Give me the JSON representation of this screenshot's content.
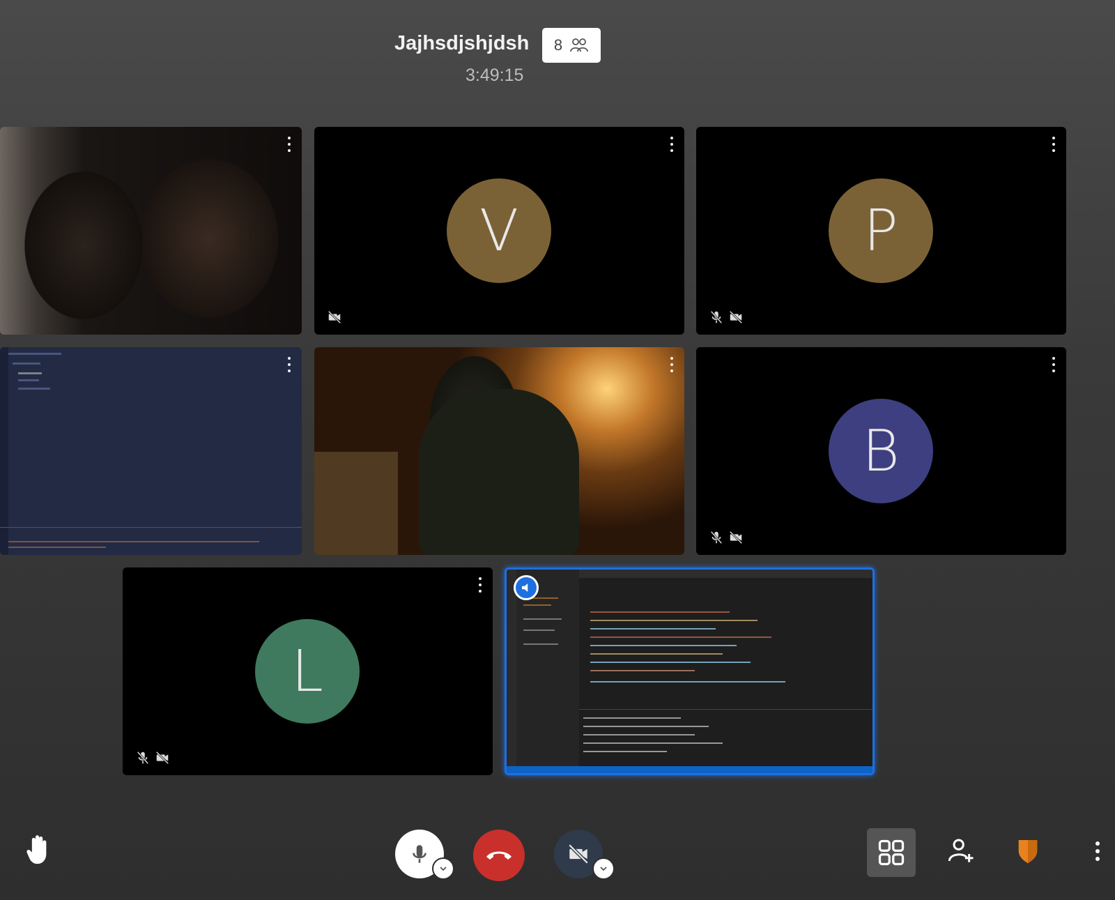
{
  "meeting": {
    "title": "Jajhsdjshjdsh",
    "participant_count": "8",
    "timer": "3:49:15"
  },
  "tiles": [
    {
      "type": "video",
      "muted_mic": false,
      "muted_cam": false
    },
    {
      "type": "avatar",
      "initial": "V",
      "color": "#7b6236",
      "muted_mic": false,
      "muted_cam": true
    },
    {
      "type": "avatar",
      "initial": "P",
      "color": "#7b6236",
      "muted_mic": true,
      "muted_cam": true
    },
    {
      "type": "screen-share",
      "muted_mic": false,
      "muted_cam": false
    },
    {
      "type": "video",
      "muted_mic": false,
      "muted_cam": false
    },
    {
      "type": "avatar",
      "initial": "B",
      "color": "#3e3f80",
      "muted_mic": true,
      "muted_cam": true
    },
    {
      "type": "avatar",
      "initial": "L",
      "color": "#3f7a5e",
      "muted_mic": true,
      "muted_cam": true
    },
    {
      "type": "screen-share",
      "active_speaker": true,
      "accent": "#1e6fe0"
    }
  ],
  "colors": {
    "hangup": "#c9302c",
    "shield": "#e8821e",
    "active_border": "#1e6fe0"
  },
  "icons": {
    "raise_hand": "hand-icon",
    "mic": "microphone-icon",
    "hangup": "phone-hangup-icon",
    "camera": "camera-off-icon",
    "tile_view": "grid-icon",
    "invite": "add-person-icon",
    "security": "shield-icon",
    "more": "vertical-dots-icon"
  }
}
